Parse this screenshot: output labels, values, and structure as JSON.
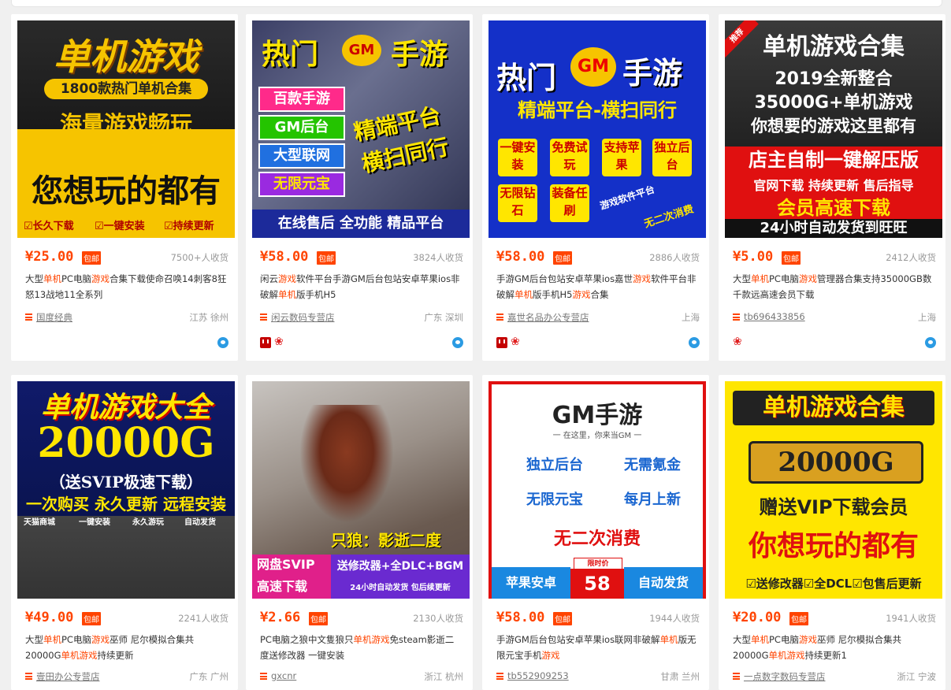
{
  "colors": {
    "price": "#ff4400",
    "accent": "#ff4400",
    "muted": "#999999"
  },
  "products": [
    {
      "price": "¥25.00",
      "badge": "包邮",
      "sold": "7500+人收货",
      "title_parts": [
        "大型",
        "单机",
        "PC电脑",
        "游戏",
        "合集下载使命召唤14刺客8狂怒13战地11全系列"
      ],
      "shop": "国度经典",
      "location": "江苏 徐州",
      "icons": [],
      "banner": {
        "line1": "单机游戏",
        "line2": "1800款热门单机合集",
        "line3": "海量游戏畅玩",
        "line4": "您想玩的都有",
        "tags": [
          "☑长久下载",
          "☑一键安装",
          "☑持续更新"
        ]
      }
    },
    {
      "price": "¥58.00",
      "badge": "包邮",
      "sold": "3824人收货",
      "title_parts": [
        "闲云",
        "游戏",
        "软件平台手游GM后台包站安卓苹果ios非破解",
        "单机",
        "版手机H5"
      ],
      "shop": "闲云数码专营店",
      "location": "广东 深圳",
      "icons": [
        "tmall",
        "flower"
      ],
      "banner": {
        "hot": "热门",
        "gm": "GM",
        "mobile": "手游",
        "items": [
          "百款手游",
          "GM后台",
          "大型联网",
          "无限元宝"
        ],
        "side1": "精端平台",
        "side2": "横扫同行",
        "footer": "在线售后 全功能 精品平台"
      }
    },
    {
      "price": "¥58.00",
      "badge": "包邮",
      "sold": "2886人收货",
      "title_parts": [
        "手游GM后台包站安卓苹果ios嘉世",
        "游戏",
        "软件平台非破解",
        "单机",
        "版手机H5",
        "游戏",
        "合集"
      ],
      "shop": "嘉世名品办公专营店",
      "location": "上海",
      "icons": [
        "tmall",
        "flower"
      ],
      "banner": {
        "hot": "热门",
        "gm": "GM",
        "mobile": "手游",
        "sub": "精端平台-横扫同行",
        "boxes": [
          "一键安装",
          "免费试玩",
          "支持苹果",
          "独立后台",
          "无限钻石",
          "装备任刷"
        ],
        "platform": "游戏软件平台",
        "once": "无二次消费"
      }
    },
    {
      "price": "¥5.00",
      "badge": "包邮",
      "sold": "2412人收货",
      "title_parts": [
        "大型",
        "单机",
        "PC电脑",
        "游戏",
        "管理器合集支持35000GB数千款远高速会员下载"
      ],
      "shop": "tb696433856",
      "location": "上海",
      "icons": [
        "flower"
      ],
      "banner": {
        "corner": "推荐",
        "line1": "单机游戏合集",
        "line2": "2019全新整合",
        "line3": "35000G+单机游戏",
        "line4": "你想要的游戏这里都有",
        "line5": "店主自制一键解压版",
        "line6": "官网下载 持续更新 售后指导",
        "line7": "会员高速下载",
        "line8": "24小时自动发货到旺旺"
      }
    },
    {
      "price": "¥49.00",
      "badge": "包邮",
      "sold": "2241人收货",
      "title_parts": [
        "大型",
        "单机",
        "PC电脑",
        "游戏",
        "巫师 尼尔模拟合集共20000G",
        "单机游戏",
        "持续更新"
      ],
      "shop": "壹田办公专营店",
      "location": "广东 广州",
      "icons": [],
      "banner": {
        "line1": "单机游戏大全",
        "line2": "20000G",
        "line3": "（送SVIP极速下载）",
        "line4": "一次购买 永久更新 远程安装",
        "tags": [
          "天猫商城",
          "一键安装",
          "永久游玩",
          "自动发货"
        ]
      }
    },
    {
      "price": "¥2.66",
      "badge": "包邮",
      "sold": "2130人收货",
      "title_parts": [
        "PC电脑之狼中文隻狼只",
        "单机游戏",
        "免steam影逝二度送修改器 一键安装"
      ],
      "shop": "gxcnr",
      "location": "浙江 杭州",
      "icons": [],
      "banner": {
        "caption": "只狼：影逝二度",
        "left1": "网盘SVIP",
        "left2": "高速下载",
        "right1": "送修改器+全DLC+BGM",
        "right2": "24小时自动发货 包后续更新"
      }
    },
    {
      "price": "¥58.00",
      "badge": "包邮",
      "sold": "1944人收货",
      "title_parts": [
        "手游GM后台包站安卓苹果ios联网非破解",
        "单机",
        "版无限元宝手机",
        "游戏"
      ],
      "shop": "tb552909253",
      "location": "甘肃 兰州",
      "icons": [],
      "banner": {
        "title": "GM手游",
        "slogan": "一 在这里，你来当GM 一",
        "items": [
          "独立后台",
          "无需氪金",
          "无限元宝",
          "每月上新"
        ],
        "once": "无二次消费",
        "left": "苹果安卓",
        "price_label": "限时价",
        "price": "58",
        "right": "自动发货"
      }
    },
    {
      "price": "¥20.00",
      "badge": "包邮",
      "sold": "1941人收货",
      "title_parts": [
        "大型",
        "单机",
        "PC电脑",
        "游戏",
        "巫师 尼尔模拟合集共20000G",
        "单机游戏",
        "持续更新1"
      ],
      "shop": "一点数字数码专营店",
      "location": "浙江 宁波",
      "icons": [],
      "banner": {
        "line1": "单机游戏合集",
        "line2": "20000G",
        "line3": "赠送VIP下载会员",
        "line4": "你想玩的都有",
        "line5": "☑送修改器☑全DCL☑包售后更新"
      }
    }
  ]
}
